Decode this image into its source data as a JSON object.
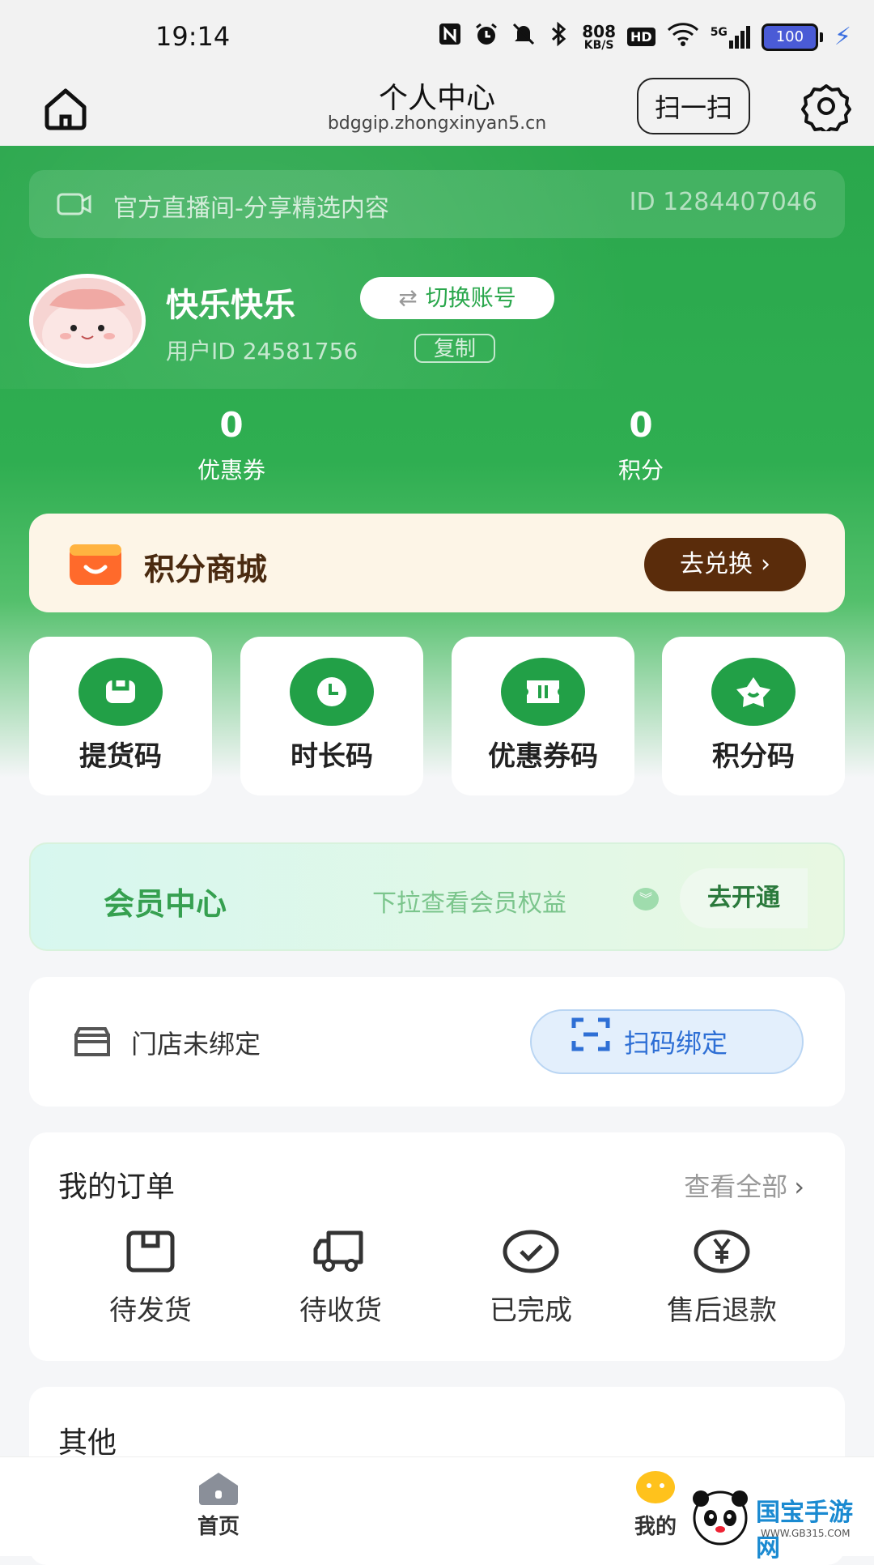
{
  "status_bar": {
    "time": "19:14",
    "net_speed_value": "808",
    "net_speed_unit": "KB/S",
    "hd": "HD",
    "signal": "5G",
    "battery": "100"
  },
  "nav": {
    "title": "个人中心",
    "url": "bdggip.zhongxinyan5.cn",
    "scan_label": "扫一扫"
  },
  "live": {
    "text": "官方直播间-分享精选内容",
    "id_text": "ID 1284407046"
  },
  "profile": {
    "username": "快乐快乐",
    "switch_label": "切换账号",
    "user_id_text": "用户ID 24581756",
    "copy_label": "复制"
  },
  "stats": [
    {
      "value": "0",
      "label": "优惠券"
    },
    {
      "value": "0",
      "label": "积分"
    }
  ],
  "mall": {
    "title": "积分商城",
    "button": "去兑换"
  },
  "codes": [
    {
      "label": "提货码",
      "icon": "bag-icon"
    },
    {
      "label": "时长码",
      "icon": "clock-icon"
    },
    {
      "label": "优惠券码",
      "icon": "ticket-icon"
    },
    {
      "label": "积分码",
      "icon": "star-icon"
    }
  ],
  "member": {
    "title": "会员中心",
    "hint": "下拉查看会员权益",
    "button": "去开通"
  },
  "store": {
    "text": "门店未绑定",
    "button": "扫码绑定"
  },
  "orders": {
    "title": "我的订单",
    "view_all": "查看全部",
    "items": [
      {
        "label": "待发货",
        "icon": "box-icon"
      },
      {
        "label": "待收货",
        "icon": "truck-icon"
      },
      {
        "label": "已完成",
        "icon": "check-icon"
      },
      {
        "label": "售后退款",
        "icon": "yen-icon"
      }
    ]
  },
  "other": {
    "title": "其他"
  },
  "tabbar": {
    "home": "首页",
    "mine": "我的"
  },
  "watermark": {
    "text": "国宝手游网",
    "url": "WWW.GB315.COM"
  },
  "colors": {
    "primary_green": "#2aa74c",
    "mall_button": "#5a2c0b",
    "store_button": "#2e6fd5"
  }
}
